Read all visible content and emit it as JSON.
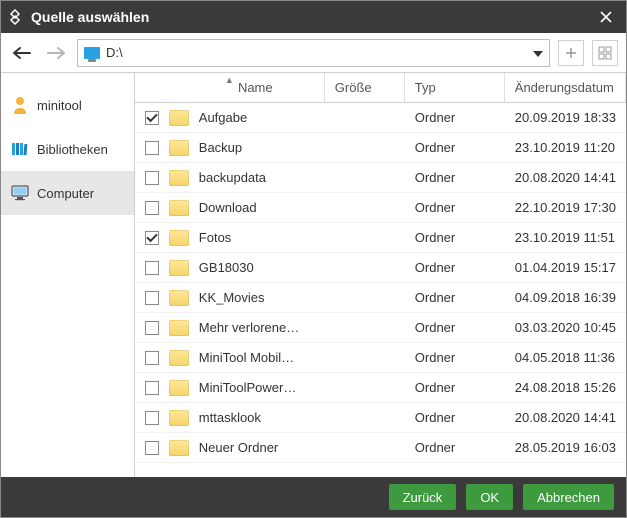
{
  "title": "Quelle auswählen",
  "path": "D:\\",
  "sidebar": {
    "items": [
      {
        "label": "minitool"
      },
      {
        "label": "Bibliotheken"
      },
      {
        "label": "Computer"
      }
    ],
    "active_index": 2
  },
  "columns": {
    "name": "Name",
    "size": "Größe",
    "type": "Typ",
    "date": "Änderungsdatum"
  },
  "rows": [
    {
      "checked": true,
      "name": "Aufgabe",
      "size": "",
      "type": "Ordner",
      "date": "20.09.2019 18:33"
    },
    {
      "checked": false,
      "name": "Backup",
      "size": "",
      "type": "Ordner",
      "date": "23.10.2019 11:20"
    },
    {
      "checked": false,
      "name": "backupdata",
      "size": "",
      "type": "Ordner",
      "date": "20.08.2020 14:41"
    },
    {
      "checked": false,
      "name": "Download",
      "size": "",
      "type": "Ordner",
      "date": "22.10.2019 17:30"
    },
    {
      "checked": true,
      "name": "Fotos",
      "size": "",
      "type": "Ordner",
      "date": "23.10.2019 11:51"
    },
    {
      "checked": false,
      "name": "GB18030",
      "size": "",
      "type": "Ordner",
      "date": "01.04.2019 15:17"
    },
    {
      "checked": false,
      "name": "KK_Movies",
      "size": "",
      "type": "Ordner",
      "date": "04.09.2018 16:39"
    },
    {
      "checked": false,
      "name": "Mehr verlorene…",
      "size": "",
      "type": "Ordner",
      "date": "03.03.2020 10:45"
    },
    {
      "checked": false,
      "name": "MiniTool Mobil…",
      "size": "",
      "type": "Ordner",
      "date": "04.05.2018 11:36"
    },
    {
      "checked": false,
      "name": "MiniToolPower…",
      "size": "",
      "type": "Ordner",
      "date": "24.08.2018 15:26"
    },
    {
      "checked": false,
      "name": "mttasklook",
      "size": "",
      "type": "Ordner",
      "date": "20.08.2020 14:41"
    },
    {
      "checked": false,
      "name": "Neuer Ordner",
      "size": "",
      "type": "Ordner",
      "date": "28.05.2019 16:03"
    }
  ],
  "buttons": {
    "back": "Zurück",
    "ok": "OK",
    "cancel": "Abbrechen"
  }
}
